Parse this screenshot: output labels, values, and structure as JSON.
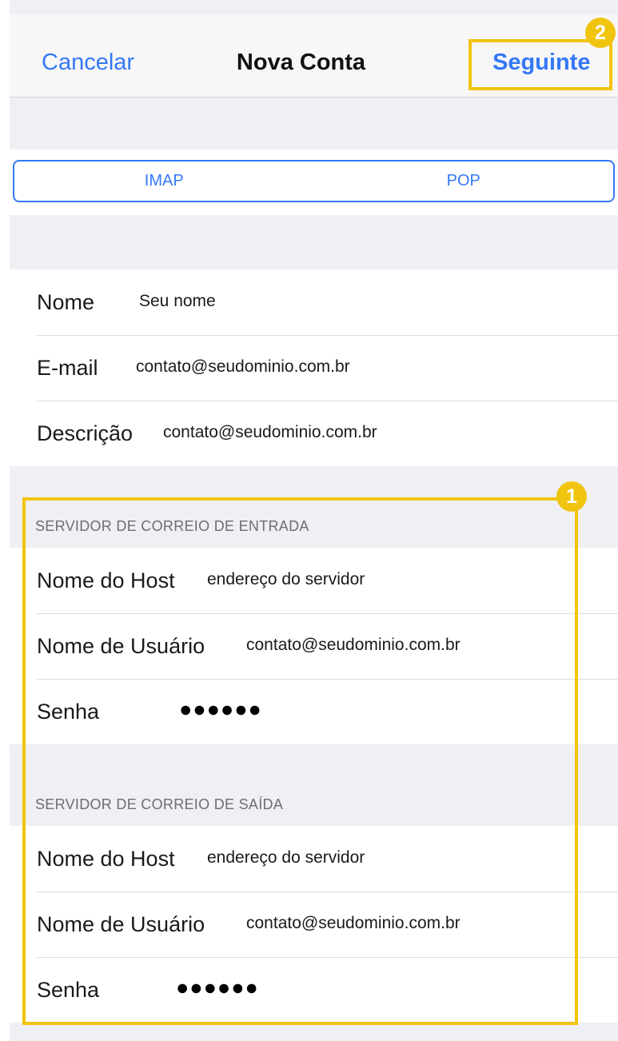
{
  "nav": {
    "cancel": "Cancelar",
    "title": "Nova Conta",
    "next": "Seguinte"
  },
  "segment": {
    "options": [
      "IMAP",
      "POP"
    ]
  },
  "account": {
    "rows": [
      {
        "label": "Nome",
        "value": "Seu nome"
      },
      {
        "label": "E-mail",
        "value": "contato@seudominio.com.br"
      },
      {
        "label": "Descrição",
        "value": "contato@seudominio.com.br"
      }
    ]
  },
  "incoming": {
    "header": "SERVIDOR DE CORREIO DE ENTRADA",
    "rows": [
      {
        "label": "Nome do Host",
        "value": "endereço do servidor"
      },
      {
        "label": "Nome de Usuário",
        "value": "contato@seudominio.com.br"
      },
      {
        "label": "Senha",
        "value": "●●●●●●"
      }
    ]
  },
  "outgoing": {
    "header": "SERVIDOR DE CORREIO DE SAÍDA",
    "rows": [
      {
        "label": "Nome do Host",
        "value": "endereço do servidor"
      },
      {
        "label": "Nome de Usuário",
        "value": "contato@seudominio.com.br"
      },
      {
        "label": "Senha",
        "value": "●●●●●●"
      }
    ]
  },
  "annotations": {
    "badge_servers": "1",
    "badge_next": "2",
    "highlight_color": "#f1c40f"
  },
  "colors": {
    "accent": "#3478f6",
    "background": "#efeff4"
  }
}
